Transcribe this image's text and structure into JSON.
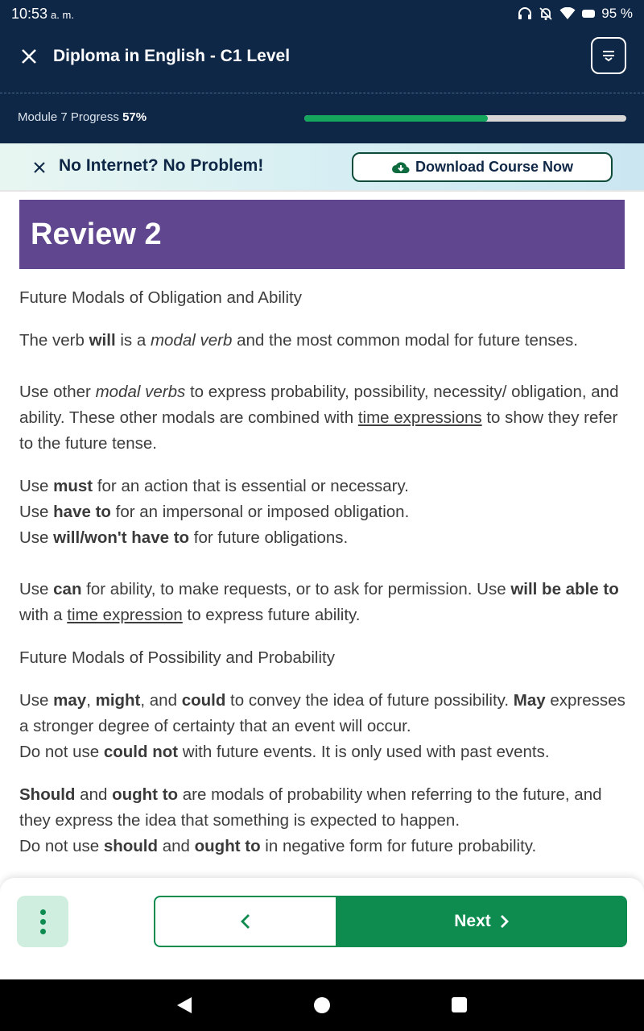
{
  "status_bar": {
    "time": "10:53",
    "ampm": "a. m.",
    "battery": "95 %",
    "icons": [
      "headphones-icon",
      "notifications-off-icon",
      "wifi-icon",
      "battery-icon"
    ]
  },
  "header": {
    "title": "Diploma in English - C1 Level",
    "progress_label": "Module 7 Progress",
    "progress_value": "57%",
    "progress_fraction": 0.57
  },
  "offline_banner": {
    "text": "No Internet? No Problem!",
    "button_label": "Download Course Now"
  },
  "review": {
    "title": "Review 2"
  },
  "content": {
    "subtitle_obligation": "Future Modals of Obligation and Ability",
    "p1": {
      "a": "The verb ",
      "b": "will",
      "c": " is a ",
      "d": "modal verb",
      "e": " and the most common modal for future tenses."
    },
    "p2": {
      "a": "Use other ",
      "b": "modal verbs",
      "c": " to express probability, possibility, necessity/ obligation, and ability. These other modals are combined with ",
      "d": "time expressions",
      "e": " to show they refer to the future tense."
    },
    "p3": {
      "l1a": "Use ",
      "l1b": "must",
      "l1c": " for an action that is essential or necessary.",
      "l2a": "Use ",
      "l2b": "have to",
      "l2c": " for an impersonal or imposed obligation.",
      "l3a": "Use ",
      "l3b": "will/won't have to",
      "l3c": " for future obligations."
    },
    "p4": {
      "a": "Use ",
      "b": "can",
      "c": " for ability, to make requests, or to ask for permission. Use ",
      "d": "will be able to",
      "e": " with a ",
      "f": "time expression",
      "g": " to express future ability."
    },
    "subtitle_possibility": "Future Modals of Possibility and Probability",
    "p5": {
      "a": "Use ",
      "b": "may",
      "c": ", ",
      "d": "might",
      "e": ", and ",
      "f": "could",
      "g": " to convey the idea of future possibility. ",
      "h": "May",
      "i": " expresses a stronger degree of certainty that an event will occur.",
      "l2a": "Do not use ",
      "l2b": "could not",
      "l2c": " with future events. It is only used with past events."
    },
    "p6": {
      "a": "Should",
      "b": " and ",
      "c": "ought to",
      "d": " are modals of probability when referring to the future, and they express the idea that something is expected to happen.",
      "l2a": "Do not use ",
      "l2b": "should",
      "l2c": " and ",
      "l2d": "ought to",
      "l2e": " in negative form for future probability."
    }
  },
  "bottom_nav": {
    "next_label": "Next"
  },
  "colors": {
    "header_bg": "#0f2746",
    "accent_green": "#0e8c50",
    "review_purple": "#5f468f"
  }
}
